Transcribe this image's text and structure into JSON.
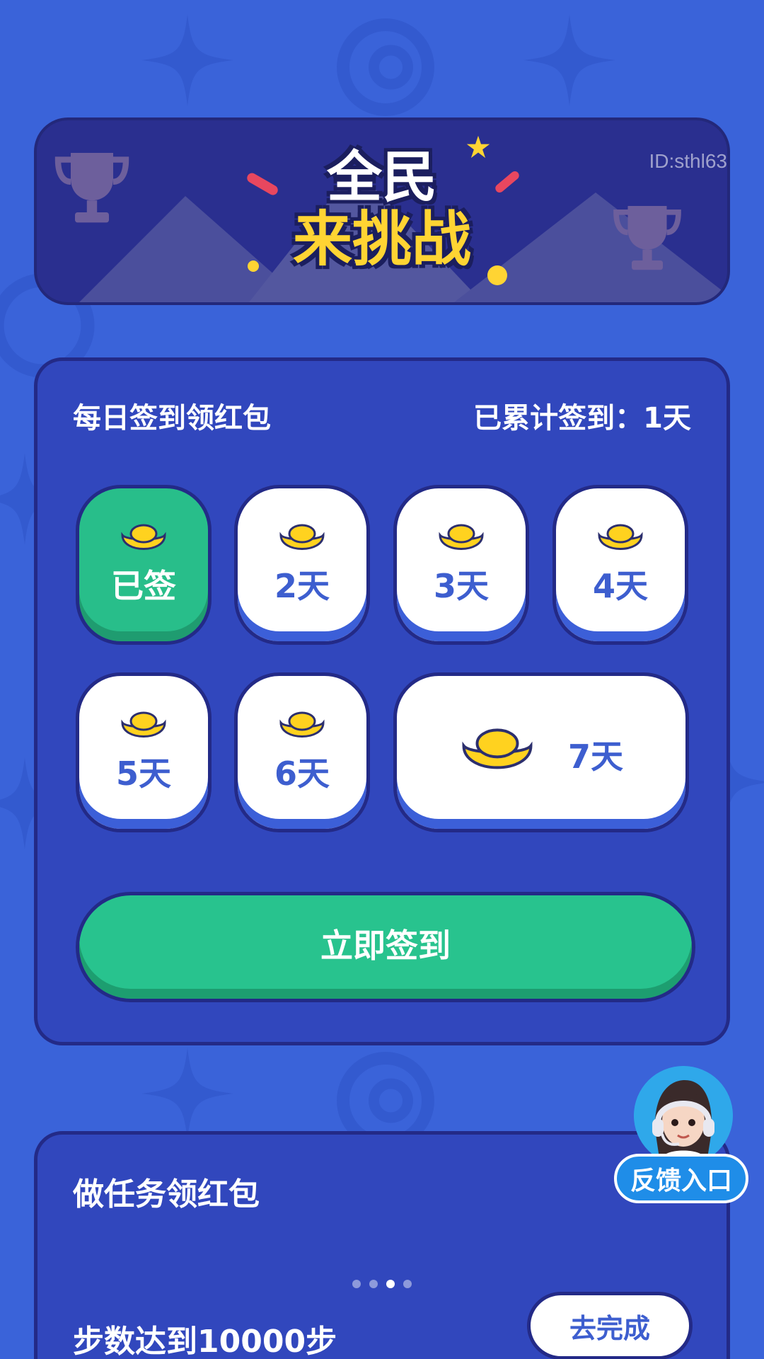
{
  "banner": {
    "title_line1": "全民",
    "title_line2": "来挑战",
    "id_text": "ID:sthl63"
  },
  "signin": {
    "title": "每日签到领红包",
    "count_text": "已累计签到：1天",
    "days": [
      {
        "label": "已签",
        "state": "done"
      },
      {
        "label": "2天",
        "state": "pending"
      },
      {
        "label": "3天",
        "state": "pending"
      },
      {
        "label": "4天",
        "state": "pending"
      },
      {
        "label": "5天",
        "state": "pending"
      },
      {
        "label": "6天",
        "state": "pending"
      },
      {
        "label": "7天",
        "state": "pending"
      }
    ],
    "button_label": "立即签到"
  },
  "tasks": {
    "title": "做任务领红包",
    "items": [
      {
        "name": "步数达到10000步",
        "button": "去完成"
      }
    ],
    "pager": {
      "count": 4,
      "active": 2
    }
  },
  "feedback": {
    "label": "反馈入口"
  },
  "colors": {
    "background": "#3a63d9",
    "panel": "#3147bd",
    "border": "#232a87",
    "accent_green": "#28c38e",
    "gold": "#ffd433",
    "day_text": "#3d5ecf"
  }
}
